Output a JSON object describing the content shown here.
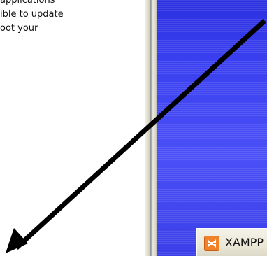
{
  "dialog": {
    "text_lines": [
      "applications",
      "ible to update",
      "oot your"
    ]
  },
  "taskbar": {
    "button_label": "XAMPP",
    "button_icon": "xampp-icon"
  },
  "annotation": {
    "type": "arrow",
    "color": "#000000"
  },
  "colors": {
    "desktop_blue": "#3b40f0",
    "panel_background": "#ffffff",
    "taskbar_button": "#ebe8d8",
    "xampp_orange": "#f0822a"
  }
}
